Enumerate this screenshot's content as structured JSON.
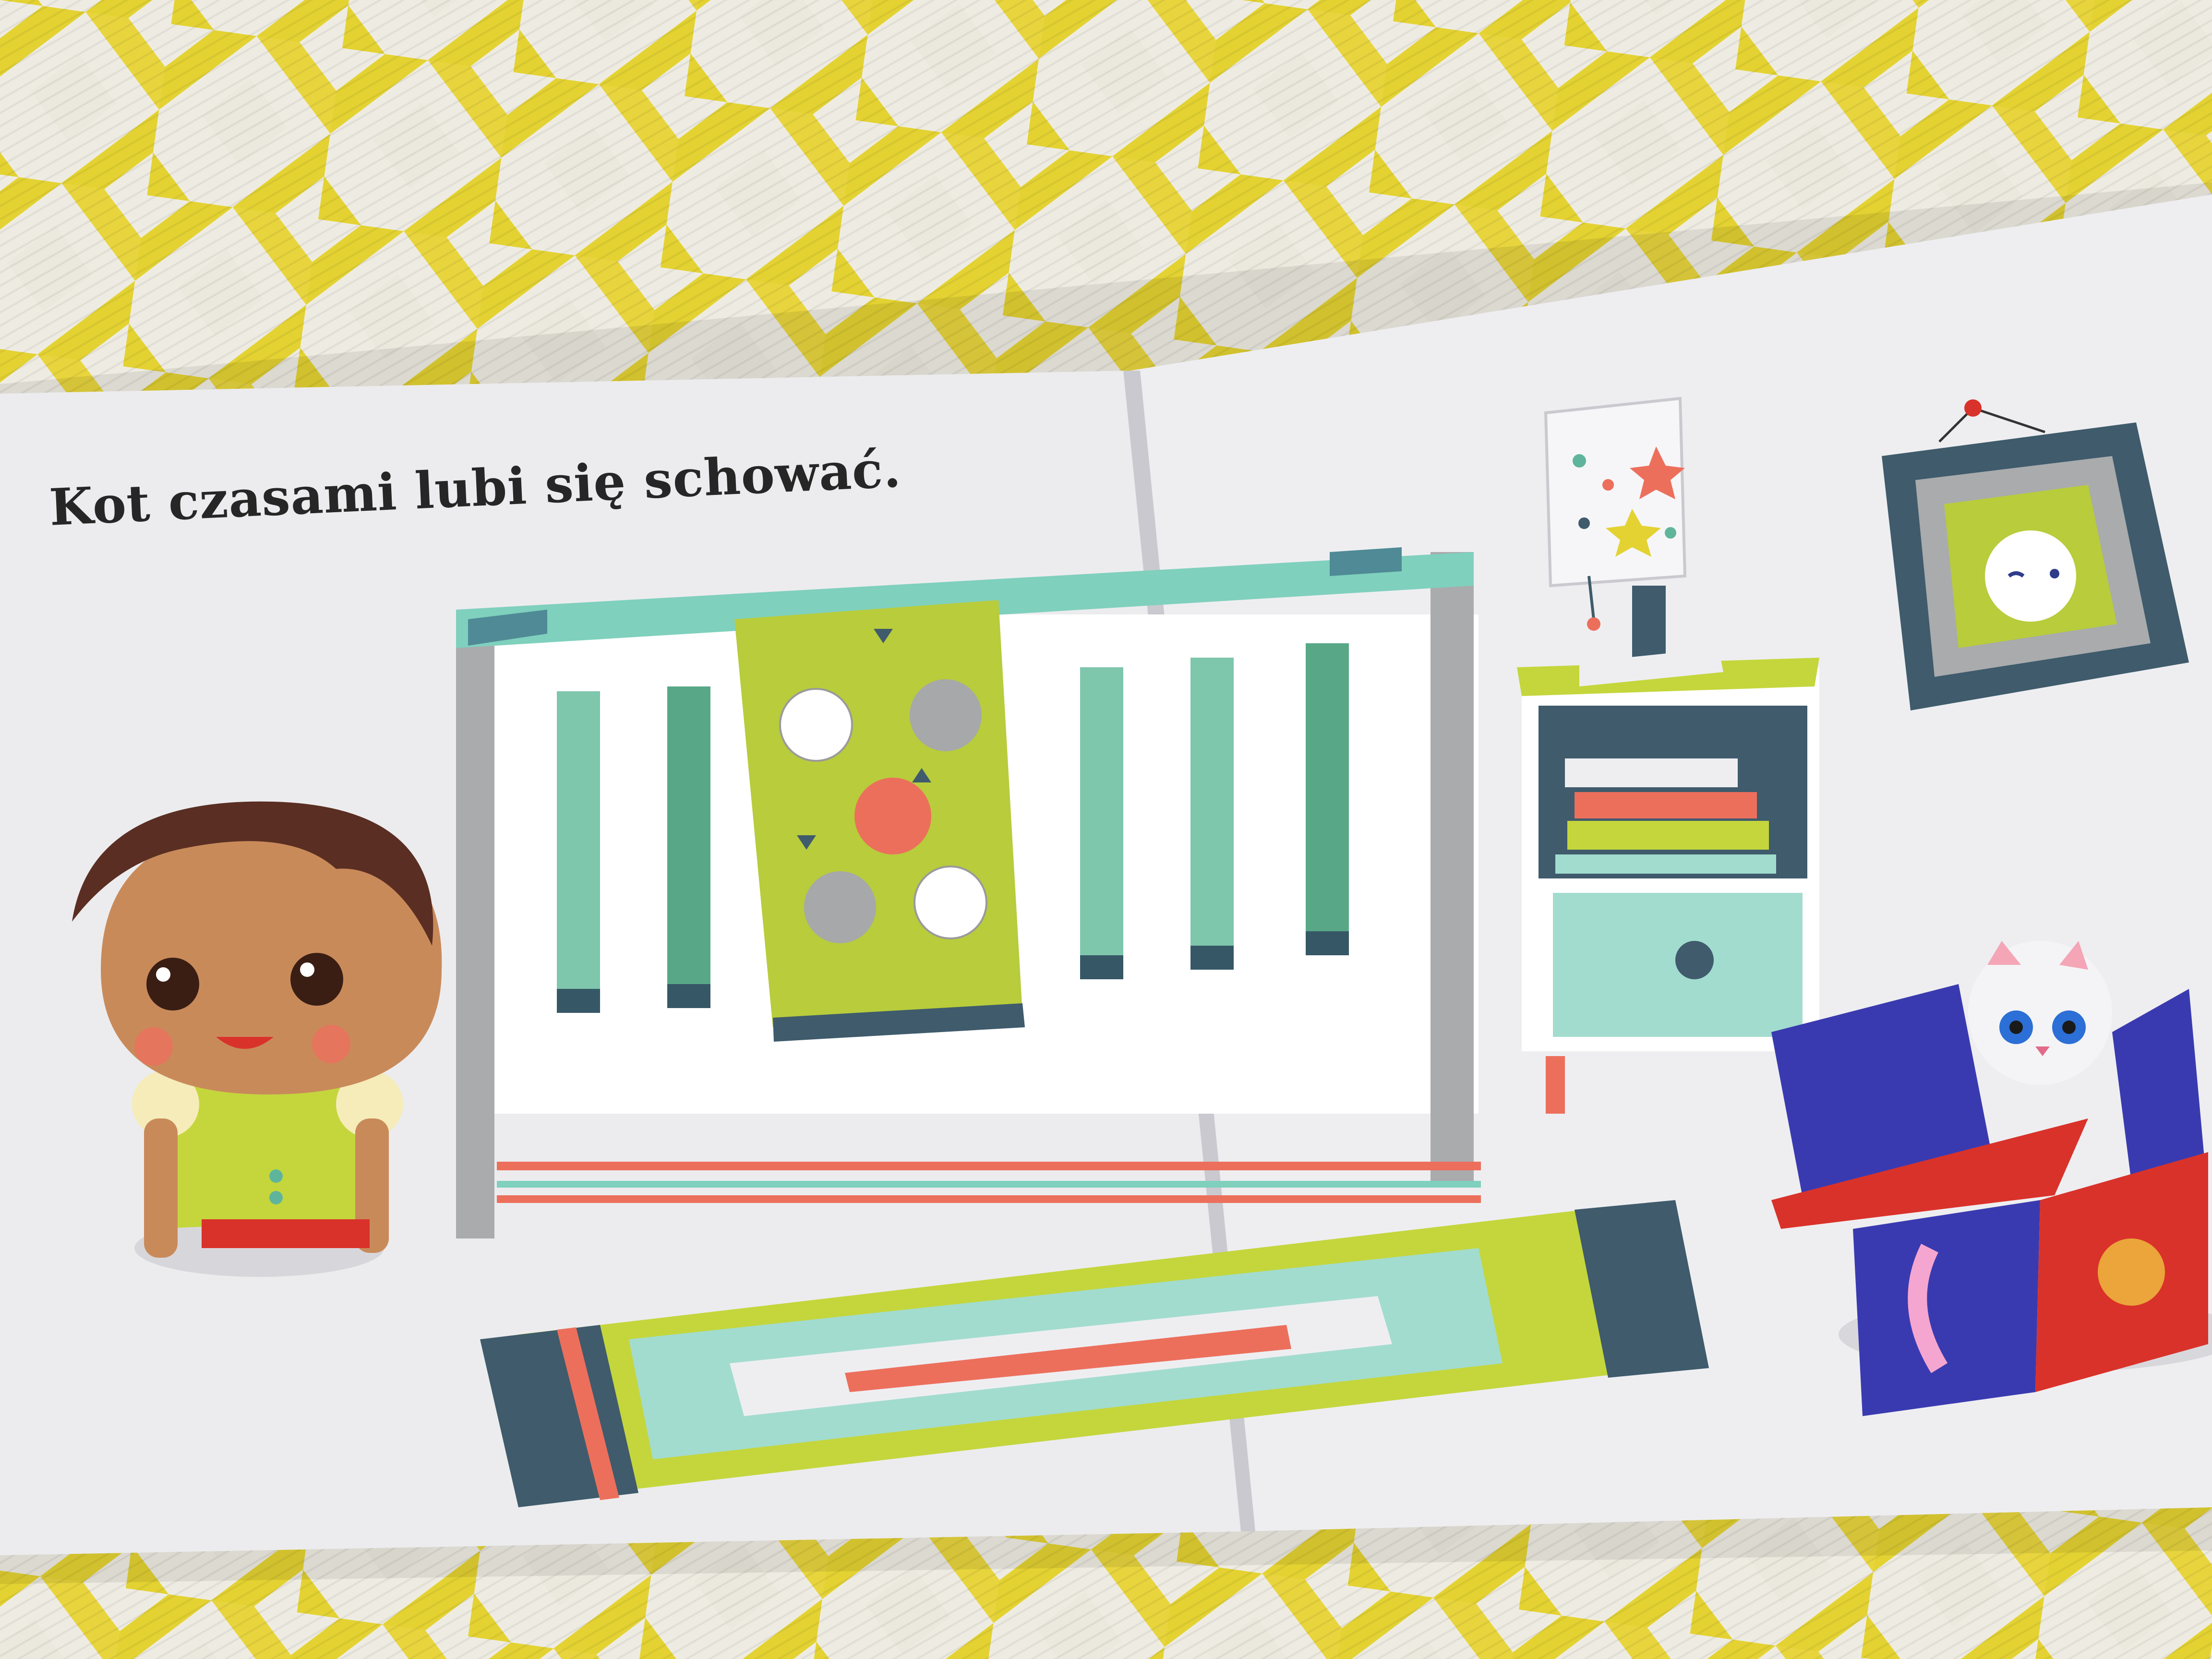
{
  "book": {
    "caption": "Kot czasami lubi się schować."
  },
  "colors": {
    "mat_yellow": "#e6d438",
    "mat_white": "#eeece2",
    "page": "#ececee",
    "lime": "#b8cc3c",
    "mint": "#9fd8cc",
    "teal": "#5fb59b",
    "slate": "#3f5b6c",
    "coral": "#ec6f5c",
    "navy_box": "#3a3ab0",
    "red": "#d9322a",
    "skin": "#c98a5a",
    "hair": "#5a2e22"
  }
}
